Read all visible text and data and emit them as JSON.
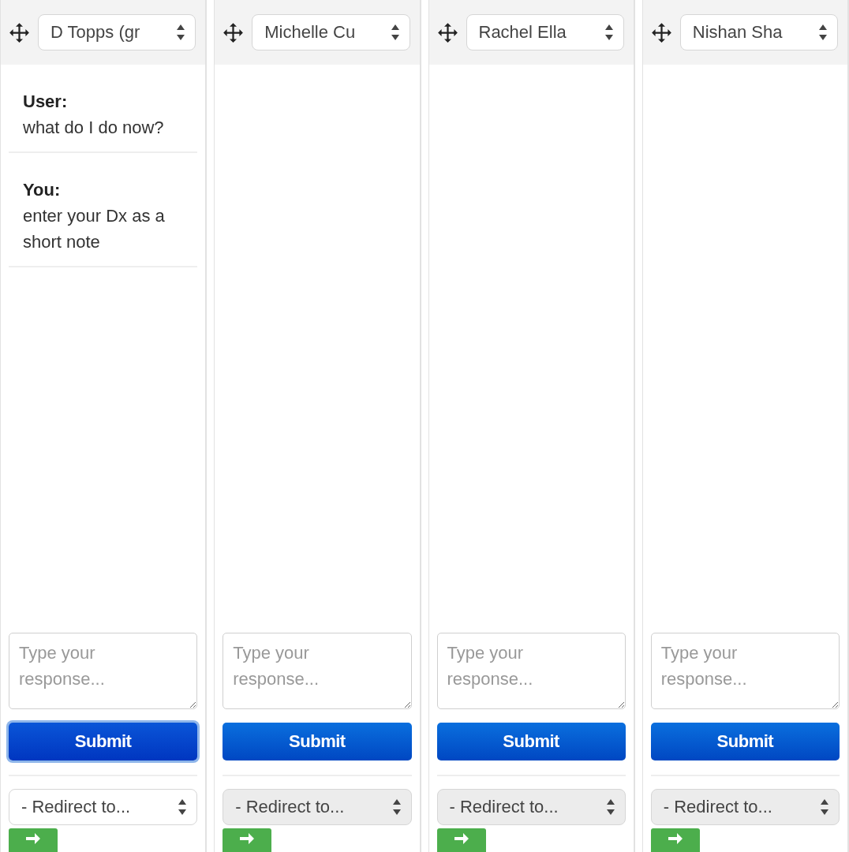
{
  "columns": [
    {
      "user_select": "D Topps (gr",
      "messages": [
        {
          "author": "User:",
          "text": "what do I do now?"
        },
        {
          "author": "You:",
          "text": "enter your Dx as a short note"
        }
      ],
      "response": {
        "placeholder": "Type your response..."
      },
      "submit": {
        "label": "Submit",
        "focused": true
      },
      "redirect": {
        "label": "- Redirect to...",
        "hovered": true
      }
    },
    {
      "user_select": "Michelle Cu",
      "response": {
        "placeholder": "Type your response..."
      },
      "submit": {
        "label": "Submit",
        "focused": false
      },
      "redirect": {
        "label": "- Redirect to...",
        "hovered": false
      }
    },
    {
      "user_select": "Rachel Ella",
      "response": {
        "placeholder": "Type your response..."
      },
      "submit": {
        "label": "Submit",
        "focused": false
      },
      "redirect": {
        "label": "- Redirect to...",
        "hovered": false
      }
    },
    {
      "user_select": "Nishan Sha",
      "response": {
        "placeholder": "Type your response..."
      },
      "submit": {
        "label": "Submit",
        "focused": false
      },
      "redirect": {
        "label": "- Redirect to...",
        "hovered": false
      }
    }
  ]
}
